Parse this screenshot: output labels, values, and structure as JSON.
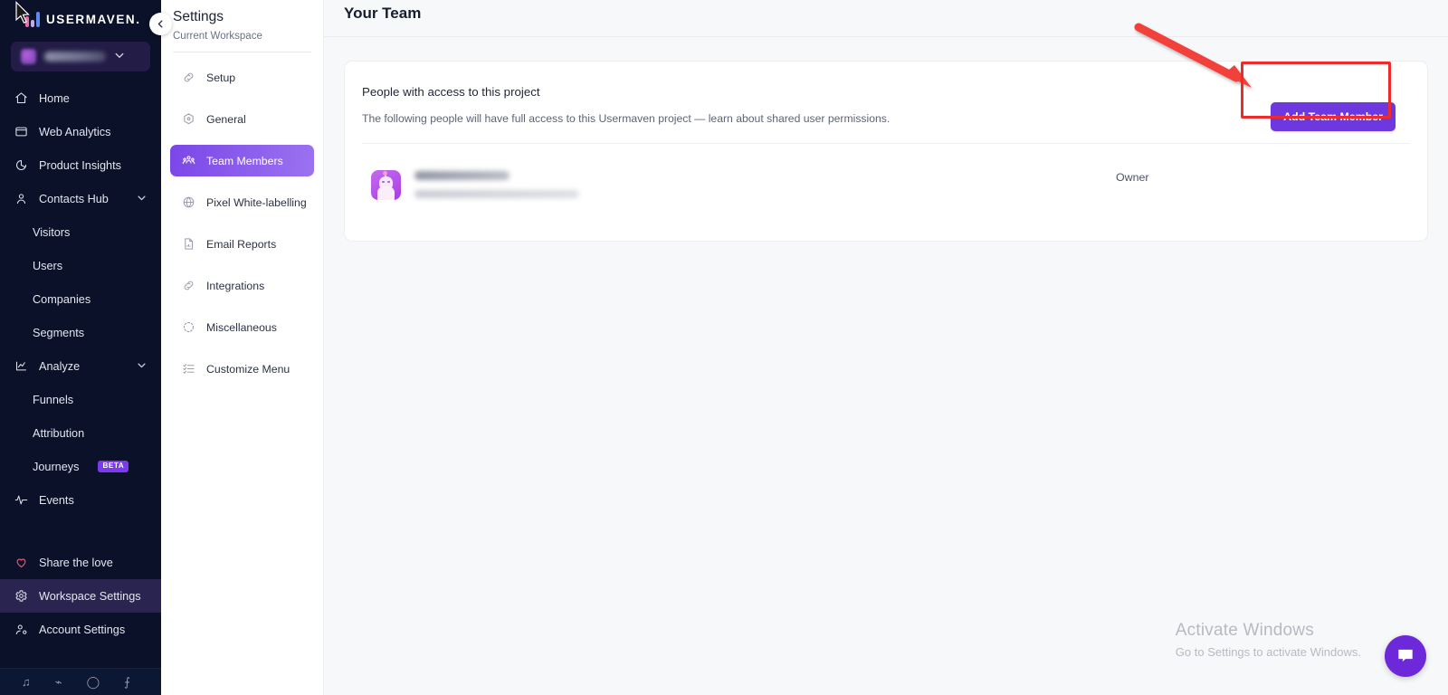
{
  "brand": {
    "logo_text": "USERMAVEN.",
    "accent_purple": "#6d38e0",
    "sidebar_bg": "#0a1128",
    "active_nav_bg": "#2a2550",
    "annotation_red": "#ef2a2a"
  },
  "sidebar": {
    "workspace_selector": {
      "name": "",
      "chevron": "chevron-down"
    },
    "items": [
      {
        "label": "Home",
        "icon": "home-icon",
        "type": "top",
        "active": false
      },
      {
        "label": "Web Analytics",
        "icon": "window-icon",
        "type": "top",
        "active": false
      },
      {
        "label": "Product Insights",
        "icon": "pie-chart-icon",
        "type": "top",
        "active": false
      },
      {
        "label": "Contacts Hub",
        "icon": "user-icon",
        "type": "top",
        "expandable": true,
        "active": false
      },
      {
        "label": "Visitors",
        "icon": "",
        "type": "sub",
        "active": false
      },
      {
        "label": "Users",
        "icon": "",
        "type": "sub",
        "active": false
      },
      {
        "label": "Companies",
        "icon": "",
        "type": "sub",
        "active": false
      },
      {
        "label": "Segments",
        "icon": "",
        "type": "sub",
        "active": false
      },
      {
        "label": "Analyze",
        "icon": "chart-icon",
        "type": "top",
        "expandable": true,
        "active": false
      },
      {
        "label": "Funnels",
        "icon": "",
        "type": "sub",
        "active": false
      },
      {
        "label": "Attribution",
        "icon": "",
        "type": "sub",
        "active": false
      },
      {
        "label": "Journeys",
        "icon": "",
        "type": "sub",
        "badge": "BETA",
        "active": false
      },
      {
        "label": "Events",
        "icon": "activity-icon",
        "type": "top",
        "active": false
      }
    ],
    "bottom_items": [
      {
        "label": "Share the love",
        "icon": "heart-icon",
        "active": false
      },
      {
        "label": "Workspace Settings",
        "icon": "gear-icon",
        "active": true
      },
      {
        "label": "Account Settings",
        "icon": "user-gear-icon",
        "active": false
      }
    ]
  },
  "settings": {
    "title": "Settings",
    "subtitle": "Current Workspace",
    "items": [
      {
        "label": "Setup",
        "icon": "link-icon",
        "active": false
      },
      {
        "label": "General",
        "icon": "hexagon-icon",
        "active": false
      },
      {
        "label": "Team Members",
        "icon": "people-icon",
        "active": true
      },
      {
        "label": "Pixel White-labelling",
        "icon": "globe-icon",
        "active": false
      },
      {
        "label": "Email Reports",
        "icon": "document-icon",
        "active": false
      },
      {
        "label": "Integrations",
        "icon": "link-icon",
        "active": false
      },
      {
        "label": "Miscellaneous",
        "icon": "dashed-circle-icon",
        "active": false
      },
      {
        "label": "Customize Menu",
        "icon": "list-check-icon",
        "active": false
      }
    ]
  },
  "main": {
    "page_title": "Your Team",
    "card": {
      "heading": "People with access to this project",
      "description": "The following people will have full access to this Usermaven project — learn about shared user permissions.",
      "add_button": "Add Team Member",
      "members": [
        {
          "name": "",
          "email": "",
          "role": "Owner",
          "avatar": "cartoon-avatar"
        }
      ]
    }
  },
  "overlay": {
    "watermark_title": "Activate Windows",
    "watermark_sub": "Go to Settings to activate Windows.",
    "chat_icon": "chat-bubble-icon"
  }
}
